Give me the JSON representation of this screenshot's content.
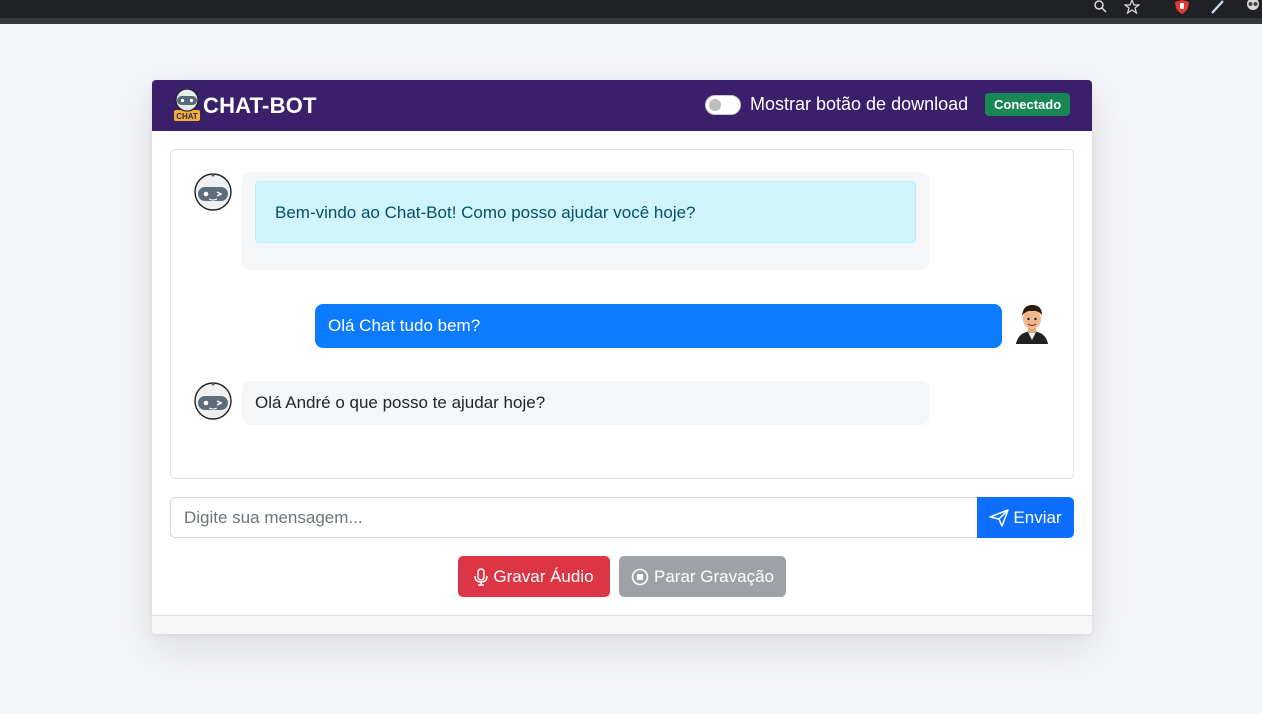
{
  "browser": {
    "icons": [
      "zoom-icon",
      "star-icon",
      "extension-shield-icon",
      "pen-icon",
      "profile-icon"
    ]
  },
  "header": {
    "brand": "CHAT-BOT",
    "logo_text": "CHAT",
    "download_toggle_label": "Mostrar botão de download",
    "download_toggle_on": false,
    "status": "Conectado",
    "background_color": "#3a1f6b",
    "status_color": "#198754"
  },
  "messages": [
    {
      "from": "bot",
      "text": "Bem-vindo ao Chat-Bot! Como posso ajudar você hoje?"
    },
    {
      "from": "user",
      "text": "Olá Chat tudo bem?"
    },
    {
      "from": "bot",
      "text": "Olá André o que posso te ajudar hoje?"
    }
  ],
  "input": {
    "placeholder": "Digite sua mensagem...",
    "value": "",
    "send_label": "Enviar"
  },
  "audio": {
    "record_label": "Gravar Áudio",
    "stop_label": "Parar Gravação",
    "record_color": "#dc3545",
    "stop_color": "#9ea2a6"
  },
  "colors": {
    "user_bubble": "#0d7bff",
    "info_bubble": "#cff4fc",
    "send_button": "#0d6efd"
  }
}
